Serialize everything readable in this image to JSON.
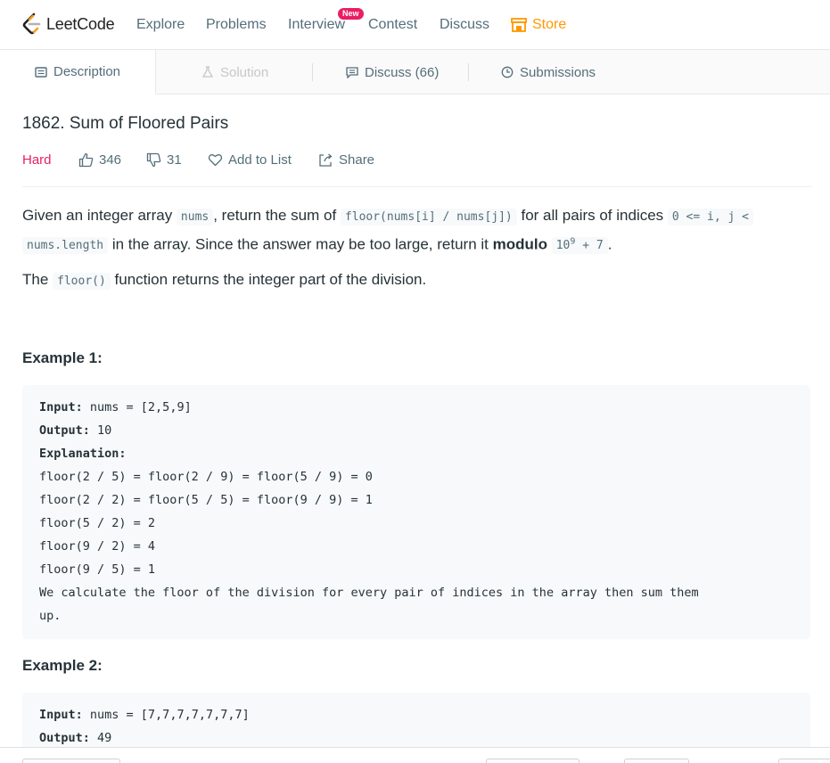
{
  "nav": {
    "logo_text": "LeetCode",
    "items": [
      "Explore",
      "Problems",
      "Interview",
      "Contest",
      "Discuss"
    ],
    "new_badge": "New",
    "store": "Store",
    "store_color": "#ff9800"
  },
  "tabs": {
    "description": "Description",
    "solution": "Solution",
    "discuss": "Discuss (66)",
    "submissions": "Submissions"
  },
  "problem": {
    "title": "1862. Sum of Floored Pairs",
    "difficulty": "Hard",
    "difficulty_color": "#e91e63",
    "likes": "346",
    "dislikes": "31",
    "add_to_list": "Add to List",
    "share": "Share"
  },
  "statement": {
    "p1_a": "Given an integer array ",
    "p1_code1": "nums",
    "p1_b": ", return the sum of ",
    "p1_code2": "floor(nums[i] / nums[j])",
    "p1_c": " for all pairs of indices ",
    "p1_code3": "0 <= i, j <",
    "p1_code4": "nums.length",
    "p1_d": " in the array. Since the answer may be too large, return it ",
    "p1_bold": "modulo",
    "p1_code5_base": "10",
    "p1_code5_exp": "9",
    "p1_code5_rest": " + 7",
    "p1_e": ".",
    "p2_a": "The ",
    "p2_code": "floor()",
    "p2_b": " function returns the integer part of the division."
  },
  "example1": {
    "title": "Example 1:",
    "input_label": "Input:",
    "input": " nums = [2,5,9]",
    "output_label": "Output:",
    "output": " 10",
    "explanation_label": "Explanation:",
    "lines": [
      "floor(2 / 5) = floor(2 / 9) = floor(5 / 9) = 0",
      "floor(2 / 2) = floor(5 / 5) = floor(9 / 9) = 1",
      "floor(5 / 2) = 2",
      "floor(9 / 2) = 4",
      "floor(9 / 5) = 1",
      "We calculate the floor of the division for every pair of indices in the array then sum them",
      "up."
    ]
  },
  "example2": {
    "title": "Example 2:",
    "input_label": "Input:",
    "input": " nums = [7,7,7,7,7,7,7]",
    "output_label": "Output:",
    "output": " 49"
  }
}
